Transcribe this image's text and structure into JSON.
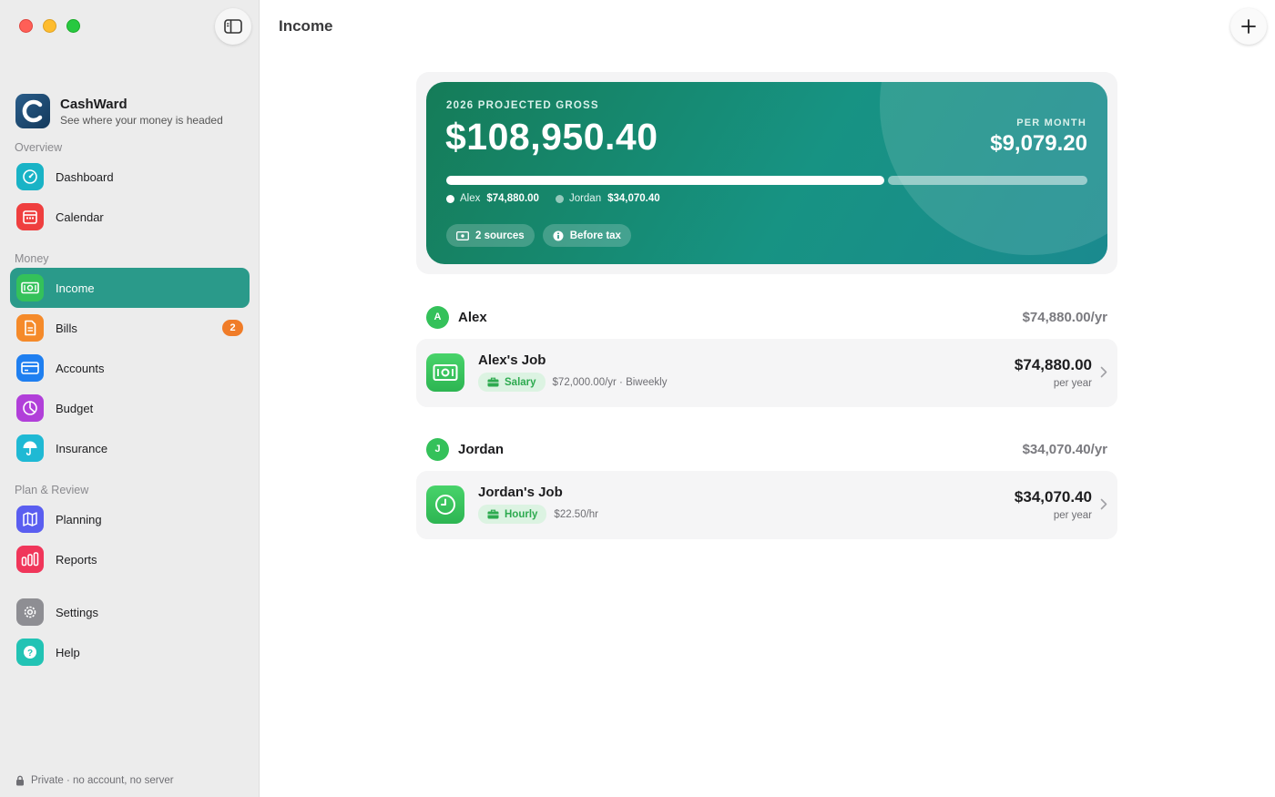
{
  "app": {
    "name": "CashWard",
    "tagline": "See where your money is headed",
    "footer": "Private · no account, no server"
  },
  "sidebar": {
    "sections": {
      "overview": "Overview",
      "money": "Money",
      "plan": "Plan & Review"
    },
    "items": [
      {
        "label": "Dashboard",
        "icon": "gauge-icon",
        "color": "#19b3c6"
      },
      {
        "label": "Calendar",
        "icon": "calendar-icon",
        "color": "#ef3f3f"
      },
      {
        "label": "Income",
        "icon": "banknote-icon",
        "color": "#34c15a",
        "active": true
      },
      {
        "label": "Bills",
        "icon": "document-icon",
        "color": "#f58a2a",
        "badge": "2"
      },
      {
        "label": "Accounts",
        "icon": "card-icon",
        "color": "#1f7ff0"
      },
      {
        "label": "Budget",
        "icon": "pie-icon",
        "color": "#b13fd9"
      },
      {
        "label": "Insurance",
        "icon": "umbrella-icon",
        "color": "#1fb9d4"
      },
      {
        "label": "Planning",
        "icon": "map-icon",
        "color": "#5a5ef0"
      },
      {
        "label": "Reports",
        "icon": "bar-chart-icon",
        "color": "#f0365a"
      },
      {
        "label": "Settings",
        "icon": "gear-icon",
        "color": "#8e8e93"
      },
      {
        "label": "Help",
        "icon": "question-icon",
        "color": "#22c3b4"
      }
    ]
  },
  "header": {
    "title": "Income"
  },
  "summary": {
    "label": "2026 PROJECTED GROSS",
    "amount": "$108,950.40",
    "per_month_label": "PER MONTH",
    "per_month_amount": "$9,079.20",
    "progress_share_first": 0.687,
    "legend": [
      {
        "name": "Alex",
        "value": "$74,880.00"
      },
      {
        "name": "Jordan",
        "value": "$34,070.40"
      }
    ],
    "chips": [
      "2 sources",
      "Before tax"
    ]
  },
  "people": [
    {
      "initial": "A",
      "name": "Alex",
      "total": "$74,880.00/yr",
      "job": {
        "title": "Alex's Job",
        "type": "Salary",
        "detail": "$72,000.00/yr · Biweekly",
        "amount": "$74,880.00",
        "per": "per year"
      }
    },
    {
      "initial": "J",
      "name": "Jordan",
      "total": "$34,070.40/yr",
      "job": {
        "title": "Jordan's Job",
        "type": "Hourly",
        "detail": "$22.50/hr",
        "amount": "$34,070.40",
        "per": "per year"
      }
    }
  ]
}
